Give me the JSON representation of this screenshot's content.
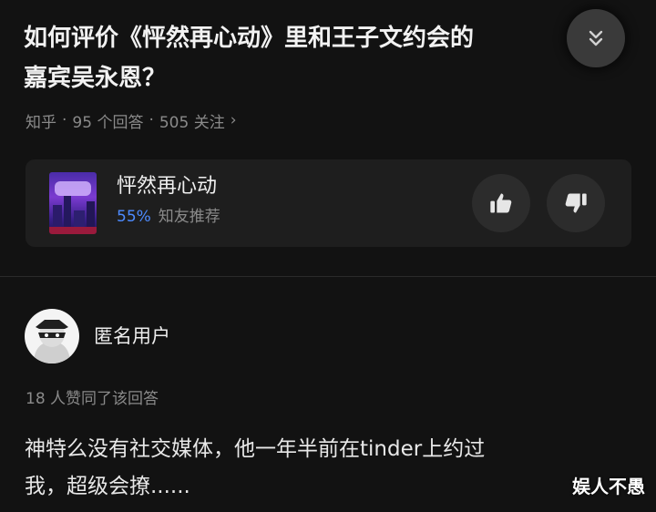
{
  "question": {
    "title_line1": "如何评价《怦然再心动》里和王子文约会的",
    "title_line2": "嘉宾吴永恩？",
    "source": "知乎",
    "answer_count": "95 个回答",
    "follower_count": "505 关注",
    "separator": "·",
    "chevron": "›"
  },
  "collapse_button": {
    "icon": "chevron-double-down-icon"
  },
  "show_card": {
    "name": "怦然再心动",
    "rating_percent": "55%",
    "rating_label": "知友推荐",
    "poster_icon": "show-poster",
    "upvote_icon": "thumbs-up-icon",
    "downvote_icon": "thumbs-down-icon",
    "accent_color": "#4d8bff"
  },
  "answer": {
    "author_name": "匿名用户",
    "avatar_icon": "anonymous-avatar-icon",
    "like_text": "18 人赞同了该回答",
    "content_line1": "神特么没有社交媒体，他一年半前在tinder上约过",
    "content_line2": "我，超级会撩......"
  },
  "watermark": "娱人不愚"
}
